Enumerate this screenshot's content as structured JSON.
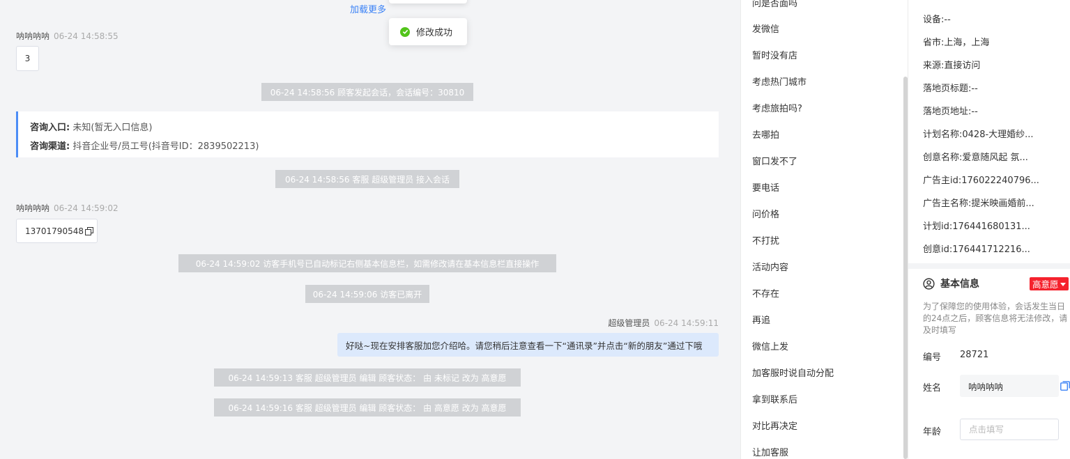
{
  "chat": {
    "load_more": "加载更多",
    "toast": "修改成功",
    "msg1": {
      "sender": "呐呐呐呐",
      "time": "06-24 14:58:55",
      "text": "3"
    },
    "sys1": "06-24 14:58:56 顾客发起会话，会话编号：30810",
    "consult": {
      "entry_label": "咨询入口:",
      "entry_value": "未知(暂无入口信息)",
      "channel_label": "咨询渠道:",
      "channel_value": "抖音企业号/员工号(抖音号ID：2839502213)"
    },
    "sys2": "06-24 14:58:56 客服 超级管理员 接入会话",
    "msg2": {
      "sender": "呐呐呐呐",
      "time": "06-24 14:59:02",
      "text": "13701790548"
    },
    "sys3": "06-24 14:59:02 访客手机号已自动标记右侧基本信息栏，如需修改请在基本信息栏直接操作",
    "sys4": "06-24 14:59:06 访客已离开",
    "agent": {
      "sender": "超级管理员",
      "time": "06-24 14:59:11",
      "text": "好哒~现在安排客服加您介绍哈。请您稍后注意查看一下“通讯录”并点击“新的朋友”通过下哦"
    },
    "sys5": "06-24 14:59:13 客服 超级管理员 编辑 顾客状态： 由 未标记 改为 高意愿",
    "sys6": "06-24 14:59:16 客服 超级管理员 编辑 顾客状态： 由 高意愿 改为 高意愿"
  },
  "quick_replies": [
    "问是否面吗",
    "发微信",
    "暂时没有店",
    "考虑热门城市",
    "考虑旅拍吗?",
    "去哪拍",
    "窗口发不了",
    "要电话",
    "问价格",
    "不打扰",
    "活动内容",
    "不存在",
    "再追",
    "微信上发",
    "加客服时说自动分配",
    "拿到联系后",
    "对比再决定",
    "让加客服"
  ],
  "ad_info": [
    {
      "label": "设备:",
      "value": "--"
    },
    {
      "label": "省市:",
      "value": "上海，上海"
    },
    {
      "label": "来源:",
      "value": "直接访问"
    },
    {
      "label": "落地页标题:",
      "value": "--"
    },
    {
      "label": "落地页地址:",
      "value": "--"
    },
    {
      "label": "计划名称:",
      "value": "0428-大理婚纱..."
    },
    {
      "label": "创意名称:",
      "value": "爱意随风起 氛..."
    },
    {
      "label": "广告主id:",
      "value": "176022240796..."
    },
    {
      "label": "广告主名称:",
      "value": "提米映画婚前..."
    },
    {
      "label": "计划id:",
      "value": "176441680131..."
    },
    {
      "label": "创意id:",
      "value": "176441712216..."
    }
  ],
  "basic_info": {
    "title": "基本信息",
    "intent_tag": "高意愿",
    "notice": "为了保障您的使用体验，会话发生当日的24点之后，顾客信息将无法修改，请及时填写",
    "id_label": "编号",
    "id_value": "28721",
    "name_label": "姓名",
    "name_value": "呐呐呐呐",
    "age_label": "年龄",
    "age_placeholder": "点击填写"
  },
  "colors": {
    "accent": "#4c8df6",
    "success": "#52c41a",
    "intent": "#f5222d",
    "agent_bubble": "#dce9fc",
    "system_msg": "#d0d2d5"
  }
}
